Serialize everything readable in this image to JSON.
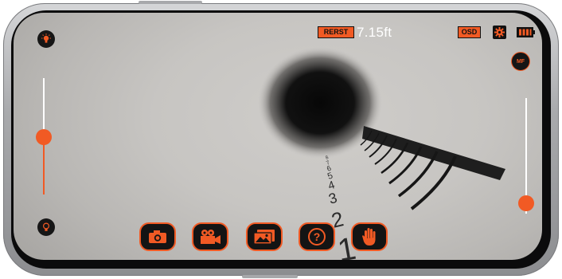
{
  "status_bar": {
    "rest_badge": "RERST",
    "distance": "7.15ft",
    "osd_badge": "OSD",
    "settings_icon": "gear-icon",
    "battery_icon": "battery-icon"
  },
  "left_controls": {
    "top_icon": "light-bulb-on-icon",
    "bottom_icon": "light-bulb-off-icon",
    "brightness_level": 0.5
  },
  "right_controls": {
    "mf_label": "MF",
    "zoom_level": 0.1
  },
  "toolbar": [
    {
      "name": "camera-button",
      "icon": "camera-icon"
    },
    {
      "name": "video-button",
      "icon": "video-camera-icon"
    },
    {
      "name": "gallery-button",
      "icon": "gallery-icon"
    },
    {
      "name": "help-button",
      "icon": "question-icon",
      "label": "?"
    },
    {
      "name": "hand-button",
      "icon": "hand-icon"
    }
  ],
  "scene_numbers": [
    "1",
    "2",
    "3",
    "4",
    "5",
    "6",
    "7",
    "8"
  ],
  "colors": {
    "accent": "#f15a24",
    "dark": "#141414"
  }
}
